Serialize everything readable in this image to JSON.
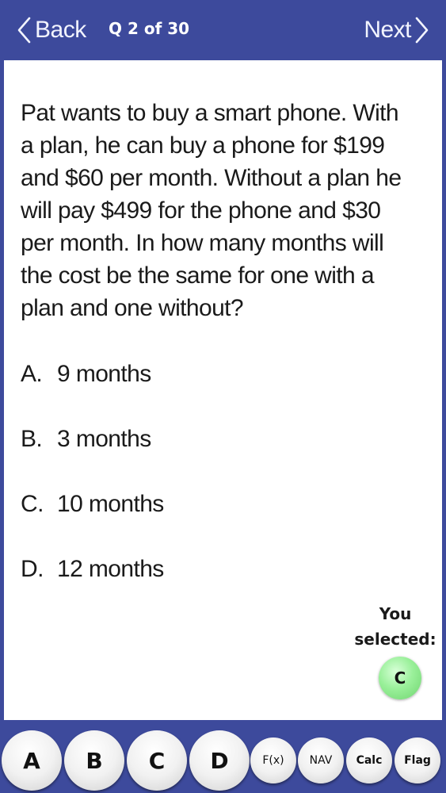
{
  "header": {
    "back_label": "Back",
    "question_counter": "Q 2 of 30",
    "next_label": "Next"
  },
  "question": {
    "text": "Pat wants to buy a smart phone. With a plan, he can buy a phone for $199 and $60 per month. Without a plan he will pay $499 for the phone and $30 per month. In how many months will the cost be the same for one with a plan and one without?",
    "options": [
      {
        "letter": "A.",
        "text": "9 months"
      },
      {
        "letter": "B.",
        "text": "3 months"
      },
      {
        "letter": "C.",
        "text": "10 months"
      },
      {
        "letter": "D.",
        "text": "12 months"
      }
    ]
  },
  "selection": {
    "label_line1": "You",
    "label_line2": "selected:",
    "selected_answer": "C"
  },
  "toolbar": {
    "buttons": [
      "A",
      "B",
      "C",
      "D",
      "F(x)",
      "NAV",
      "Calc",
      "Flag"
    ]
  },
  "colors": {
    "header_bg": "#3d4a9c",
    "selected_badge": "#9af09a"
  }
}
